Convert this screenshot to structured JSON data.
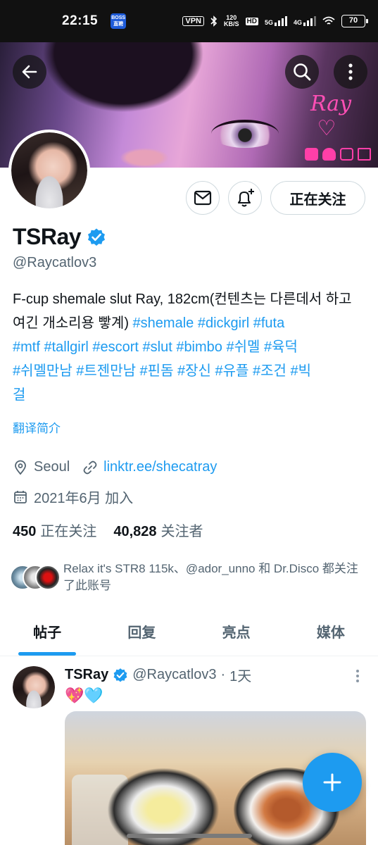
{
  "status_bar": {
    "time": "22:15",
    "vpn": "VPN",
    "speed_value": "120",
    "speed_unit": "KB/S",
    "hd": "HD",
    "net_5g": "5G",
    "net_4g": "4G",
    "battery": "70"
  },
  "header": {
    "back_icon": "arrow-left-icon",
    "search_icon": "search-icon",
    "more_icon": "more-vertical-icon"
  },
  "profile": {
    "name": "TSRay",
    "handle": "@Raycatlov3",
    "verified": true,
    "bio_plain": "F-cup shemale slut Ray, 182cm(컨텐츠는 다른데서 하고 여긴 개소리용 빻계)",
    "bio_tags_line1": "#shemale #dickgirl #futa",
    "bio_tags_line2": "#mtf #tallgirl #escort #slut #bimbo #쉬멜 #육덕",
    "bio_tags_line3": "#쉬멜만남 #트젠만남 #핀돔 #장신 #유플 #조건 #빅",
    "bio_tags_line4": "걸",
    "translate": "翻译简介",
    "location": "Seoul",
    "link": "linktr.ee/shecatray",
    "joined": "2021年6月 加入",
    "following_count": "450",
    "following_label": "正在关注",
    "followers_count": "40,828",
    "followers_label": "关注者",
    "followed_by": "Relax it's STR8 115k、@ador_unno 和 Dr.Disco 都关注了此账号"
  },
  "actions": {
    "follow_label": "正在关注",
    "message_icon": "mail-icon",
    "notify_icon": "bell-plus-icon"
  },
  "tabs": [
    {
      "label": "帖子",
      "active": true
    },
    {
      "label": "回复",
      "active": false
    },
    {
      "label": "亮点",
      "active": false
    },
    {
      "label": "媒体",
      "active": false
    }
  ],
  "tweet": {
    "name": "TSRay",
    "handle": "@Raycatlov3",
    "separator": "·",
    "time": "1天",
    "text": "💖🩵"
  },
  "colors": {
    "accent": "#1d9bf0",
    "text": "#0f1419",
    "muted": "#536471"
  }
}
